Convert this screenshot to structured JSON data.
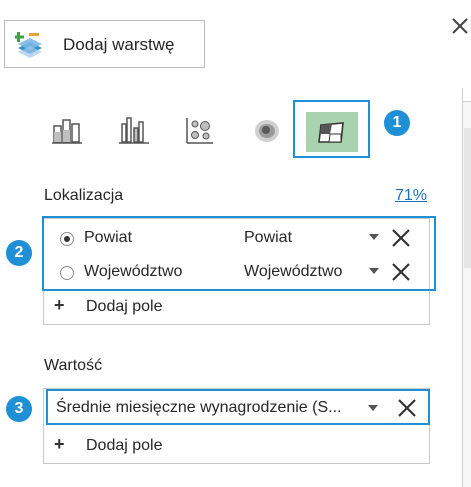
{
  "toolbar": {
    "add_layer_label": "Dodaj warstwę"
  },
  "viz_types": [
    {
      "icon": "stacked-column-icon"
    },
    {
      "icon": "clustered-column-icon"
    },
    {
      "icon": "bubble-icon"
    },
    {
      "icon": "heat-map-icon"
    },
    {
      "icon": "region-map-icon",
      "selected": true
    }
  ],
  "callouts": [
    "1",
    "2",
    "3"
  ],
  "location": {
    "label": "Lokalizacja",
    "match_pct": "71%",
    "fields": [
      {
        "name": "Powiat",
        "type": "Powiat",
        "selected": true
      },
      {
        "name": "Województwo",
        "type": "Województwo",
        "selected": false
      }
    ],
    "add_field_label": "Dodaj pole"
  },
  "value": {
    "label": "Wartość",
    "field": "Średnie miesięczne wynagrodzenie (S...",
    "add_field_label": "Dodaj pole"
  },
  "colors": {
    "accent": "#1f8fd6",
    "selected_bg": "#a9d3ae",
    "link": "#1f6fbf"
  }
}
